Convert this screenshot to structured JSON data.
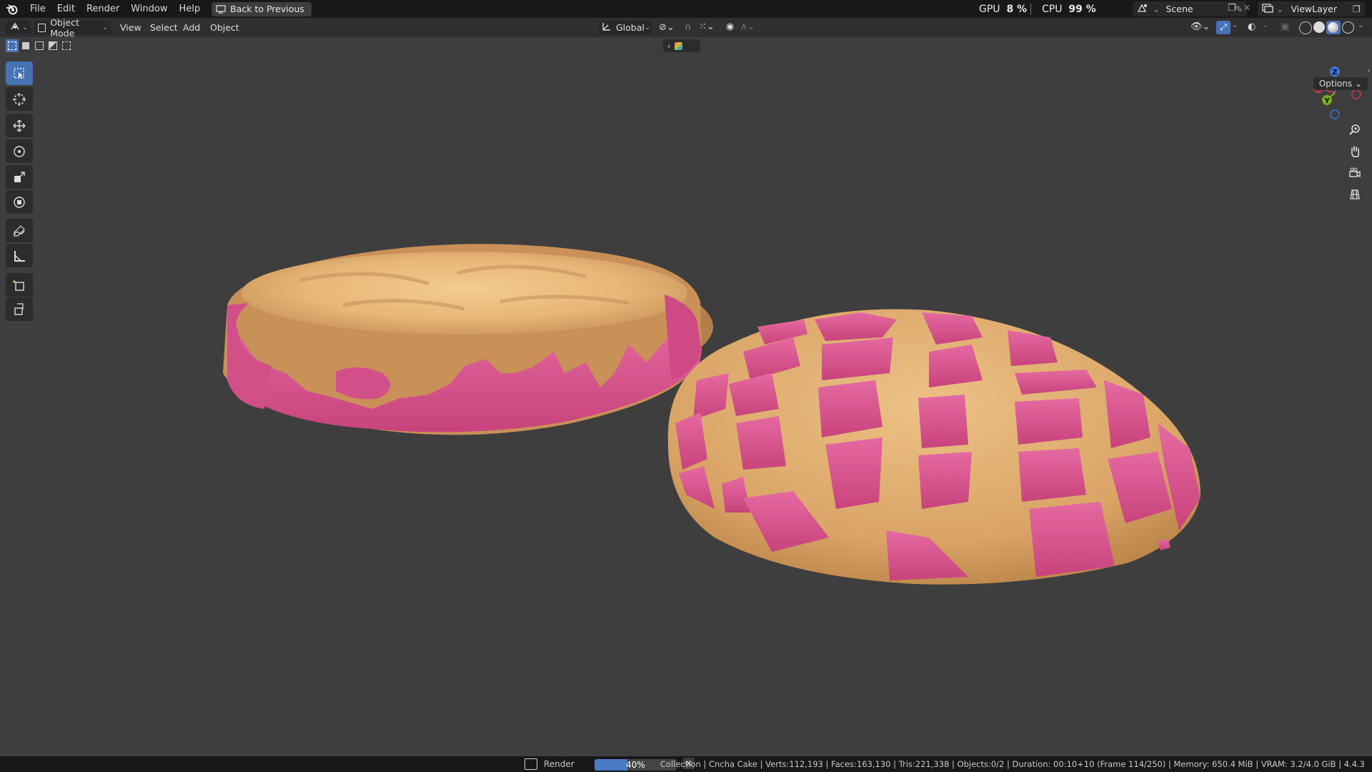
{
  "topbar": {
    "menus": [
      "File",
      "Edit",
      "Render",
      "Window",
      "Help"
    ],
    "back_button": "Back to Previous",
    "gpu_label": "GPU",
    "gpu_value": "8 %",
    "cpu_label": "CPU",
    "cpu_value": "99 %",
    "scene": "Scene",
    "view_layer": "ViewLayer"
  },
  "header": {
    "mode": "Object Mode",
    "menus": [
      "View",
      "Select",
      "Add",
      "Object"
    ],
    "transform_orientation": "Global"
  },
  "viewport": {
    "options_label": "Options",
    "gizmo": {
      "x": "X",
      "y": "Y",
      "z": "Z"
    }
  },
  "statusbar": {
    "render_label": "Render",
    "progress": 0.4,
    "progress_text": "40%",
    "stats": "Collection | Cncha Cake | Verts:112,193 | Faces:163,130 | Tris:221,338 | Objects:0/2 | Duration: 00:10+10 (Frame 114/250) | Memory: 650.4 MiB | VRAM: 3.2/4.0 GiB | 4.4.3"
  },
  "colors": {
    "topbar_bg": "#181818",
    "viewport_bg": "#3e3e3e",
    "accent": "#4772b3",
    "pink": "#d84e8a",
    "bread": "#e8b579"
  },
  "icons": [
    "blender-logo",
    "select-box-icon",
    "cursor-icon",
    "move-icon",
    "rotate-icon",
    "scale-icon",
    "transform-icon",
    "annotate-icon",
    "measure-icon",
    "add-cube-icon",
    "extrude-icon",
    "zoom-icon",
    "hand-icon",
    "camera-icon",
    "grid-icon"
  ]
}
